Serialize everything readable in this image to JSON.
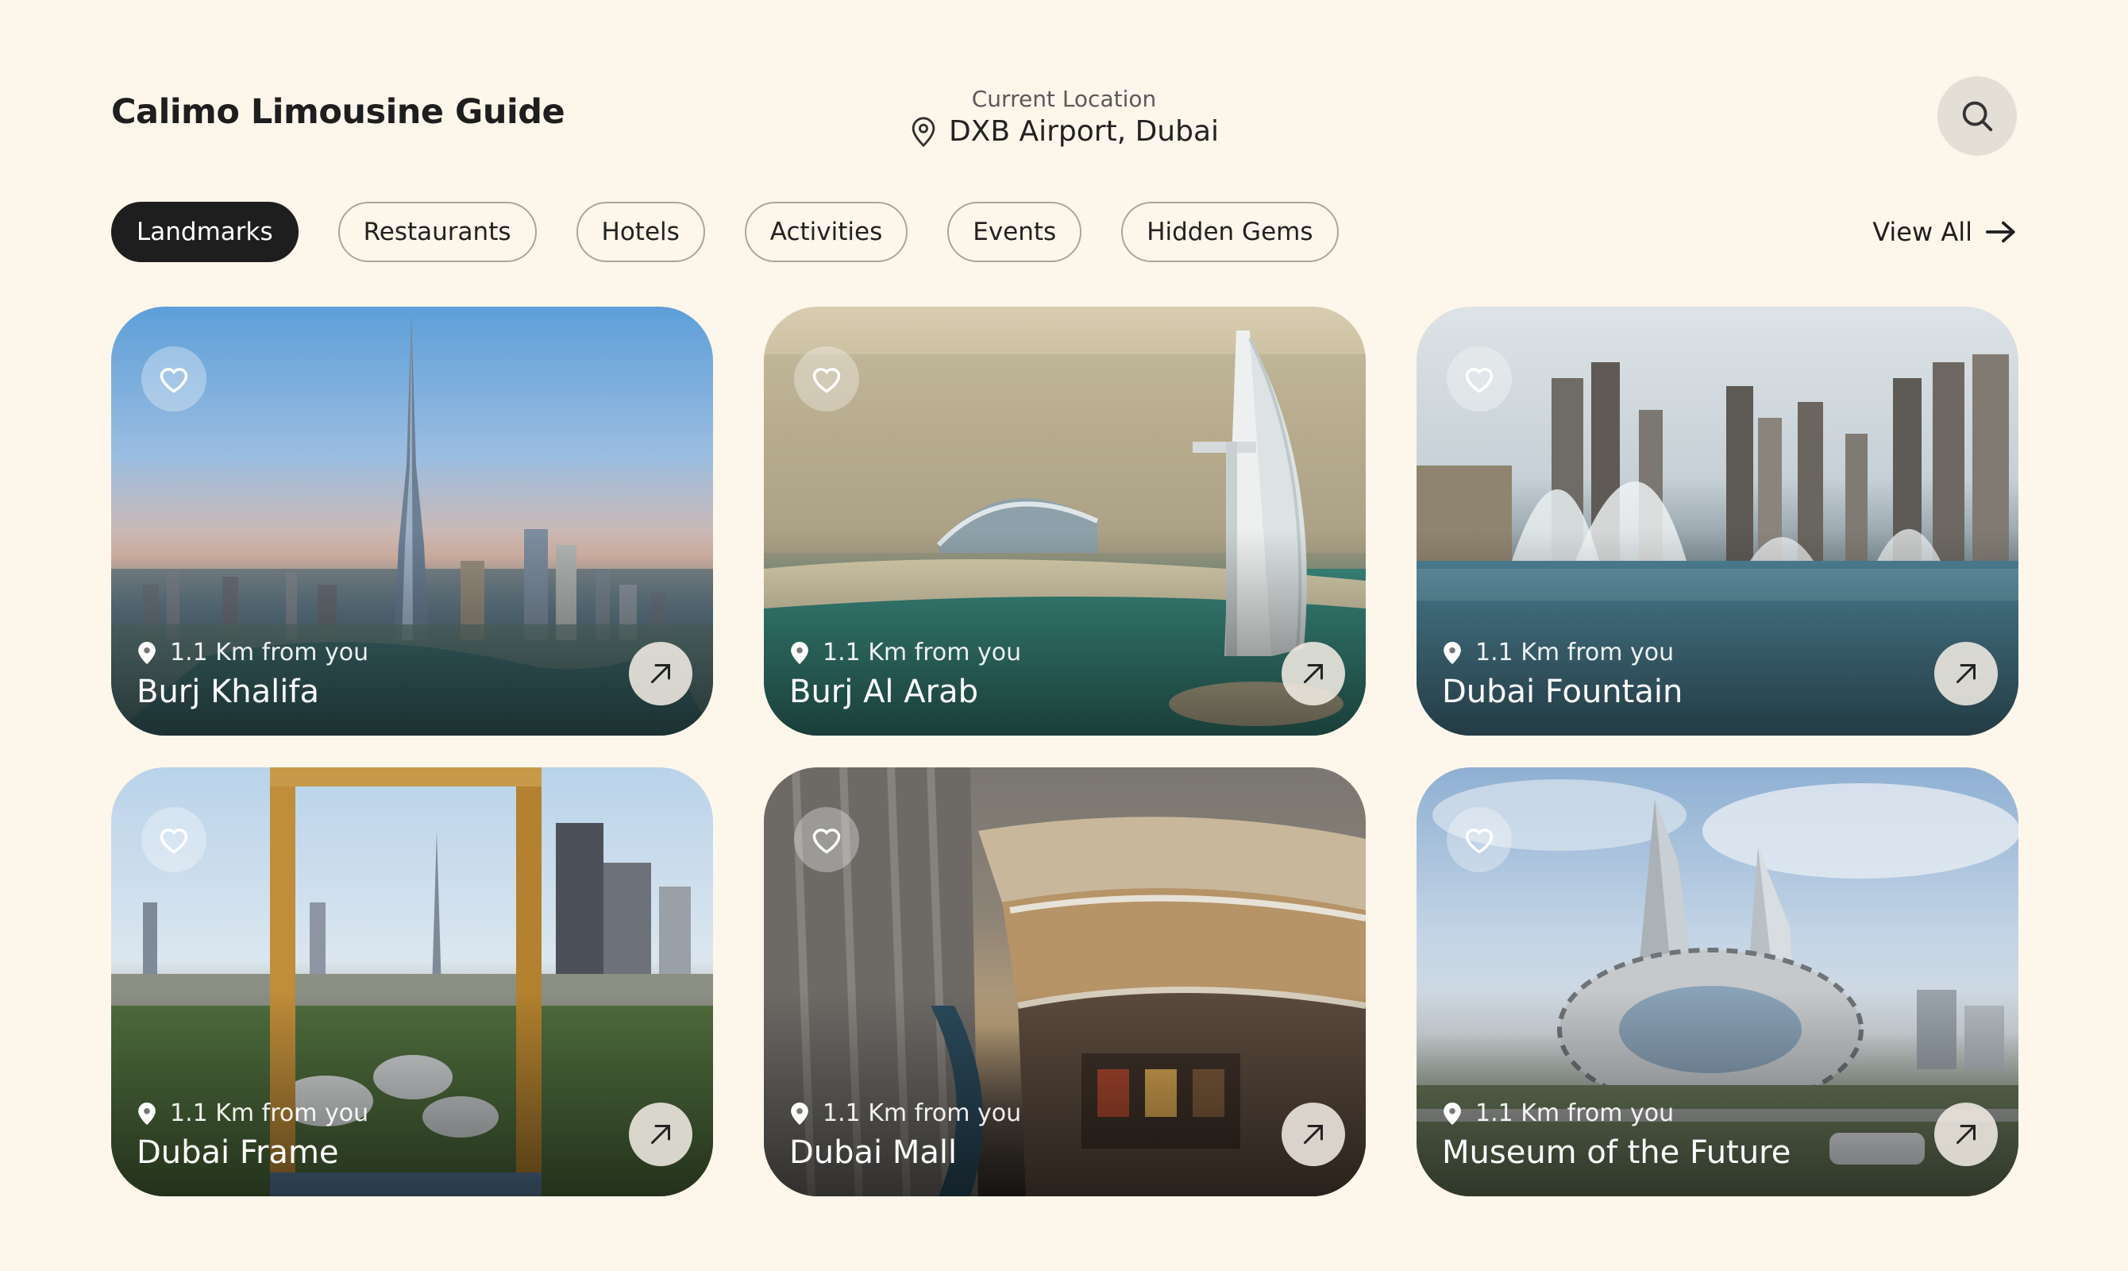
{
  "header": {
    "app_title": "Calimo Limousine Guide",
    "location_label": "Current Location",
    "location_value": "DXB Airport, Dubai",
    "search_icon": "search-icon"
  },
  "filters": {
    "chips": [
      {
        "label": "Landmarks",
        "active": true
      },
      {
        "label": "Restaurants",
        "active": false
      },
      {
        "label": "Hotels",
        "active": false
      },
      {
        "label": "Activities",
        "active": false
      },
      {
        "label": "Events",
        "active": false
      },
      {
        "label": "Hidden Gems",
        "active": false
      }
    ],
    "view_all_label": "View All"
  },
  "cards": [
    {
      "name": "Burj Khalifa",
      "distance": "1.1 Km from you"
    },
    {
      "name": "Burj Al Arab",
      "distance": "1.1 Km from you"
    },
    {
      "name": "Dubai Fountain",
      "distance": "1.1 Km from you"
    },
    {
      "name": "Dubai Frame",
      "distance": "1.1 Km from you"
    },
    {
      "name": "Dubai Mall",
      "distance": "1.1 Km from you"
    },
    {
      "name": "Museum of the Future",
      "distance": "1.1 Km from you"
    }
  ],
  "colors": {
    "background": "#fdf6ea",
    "active_chip": "#1e1e1e",
    "text": "#1e1e1e"
  }
}
